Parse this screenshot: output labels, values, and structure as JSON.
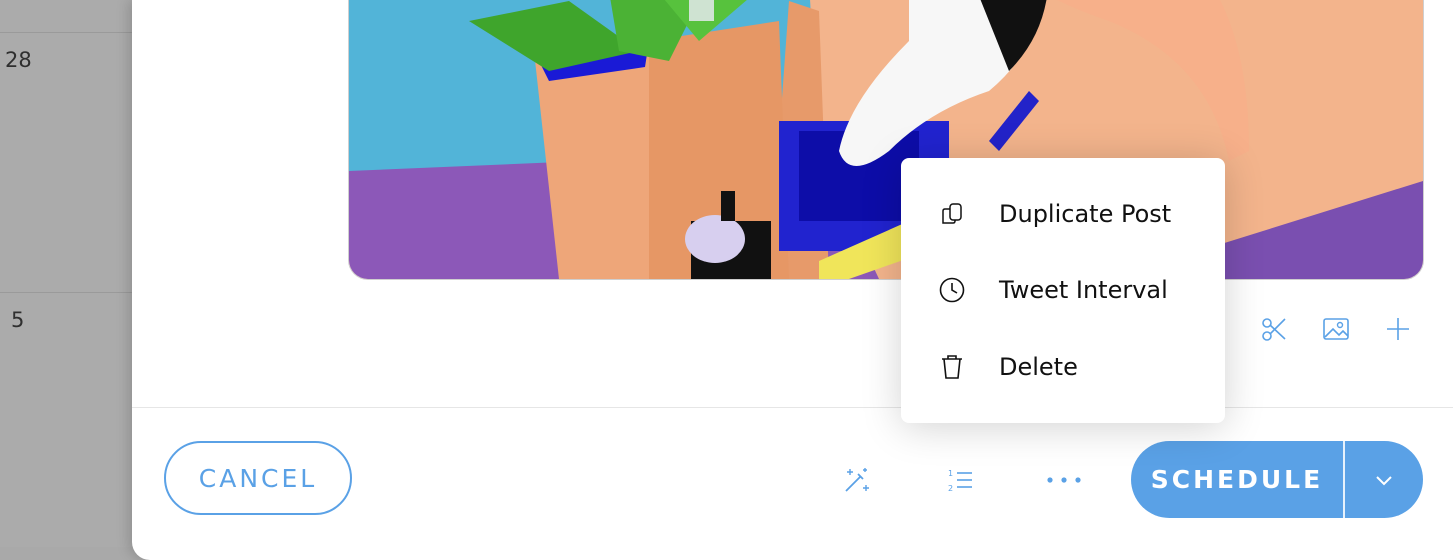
{
  "calendar": {
    "days": [
      "28",
      "5"
    ]
  },
  "context_menu": {
    "items": [
      {
        "label": "Duplicate Post",
        "icon": "duplicate-icon"
      },
      {
        "label": "Tweet Interval",
        "icon": "clock-icon"
      },
      {
        "label": "Delete",
        "icon": "trash-icon"
      }
    ]
  },
  "footer": {
    "cancel_label": "CANCEL",
    "schedule_label": "SCHEDULE"
  },
  "colors": {
    "accent": "#5aa1e6",
    "backdrop": "#ababab"
  },
  "icons": {
    "image_tools": [
      "scissors-icon",
      "image-icon",
      "plus-icon"
    ],
    "footer_tools": [
      "magic-wand-icon",
      "numbered-list-icon",
      "more-dots-icon"
    ],
    "schedule_dropdown": "chevron-down-icon"
  }
}
